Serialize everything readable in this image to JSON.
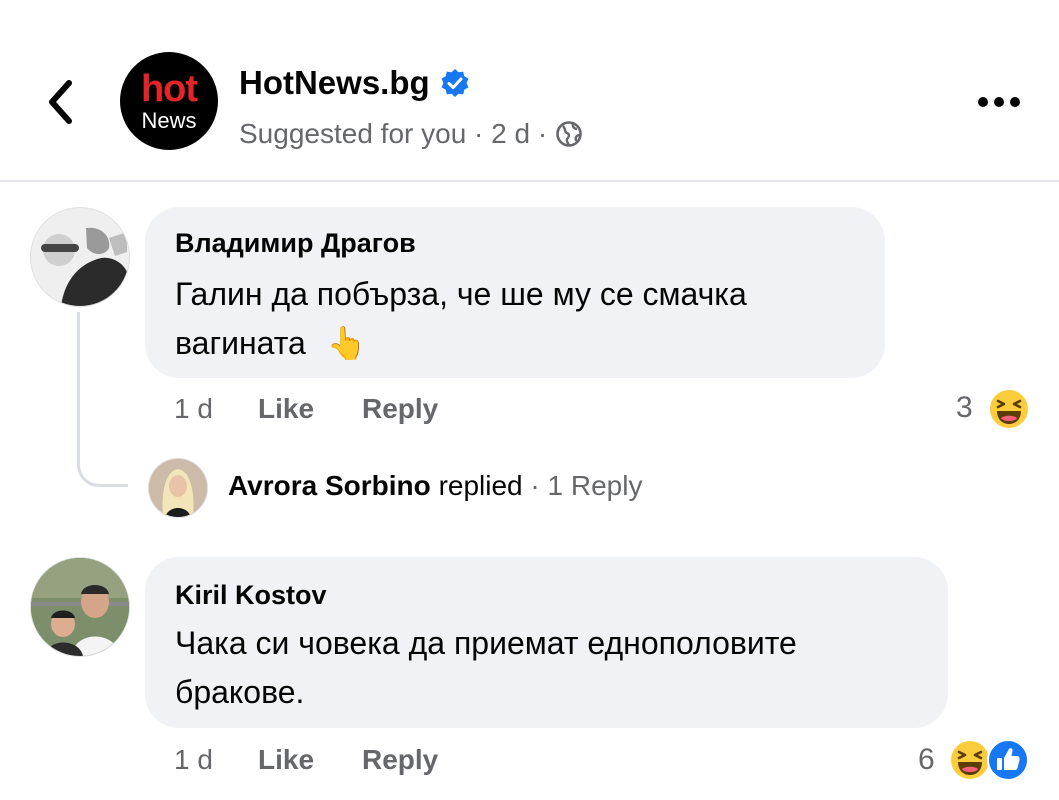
{
  "header": {
    "page_name": "HotNews.bg",
    "logo_top": "hot",
    "logo_bottom": "News",
    "subtitle": "Suggested for you · 2 d ·",
    "icons": {
      "back": "chevron-left-icon",
      "verified": "verified-badge-icon",
      "privacy": "globe-icon",
      "more": "more-options-icon"
    },
    "accent_color": "#1877f2",
    "logo_color": "#e5242a"
  },
  "comments": [
    {
      "author": "Владимир Драгов",
      "text_line1": "Галин да побърза, че ше му се смачка",
      "text_line2": "вагината",
      "emoji": "👆",
      "time": "1 d",
      "like_label": "Like",
      "reply_label": "Reply",
      "reaction_count": "3",
      "reactions": [
        "haha-reaction-icon"
      ],
      "reply_summary": {
        "name": "Avrora Sorbino",
        "verb": "replied",
        "separator": "·",
        "count_text": "1 Reply"
      }
    },
    {
      "author": "Kiril Kostov",
      "text_line1": "Чака си човека да приемат еднополовите",
      "text_line2": "бракове.",
      "time": "1 d",
      "like_label": "Like",
      "reply_label": "Reply",
      "reaction_count": "6",
      "reactions": [
        "haha-reaction-icon",
        "like-reaction-icon"
      ]
    }
  ]
}
